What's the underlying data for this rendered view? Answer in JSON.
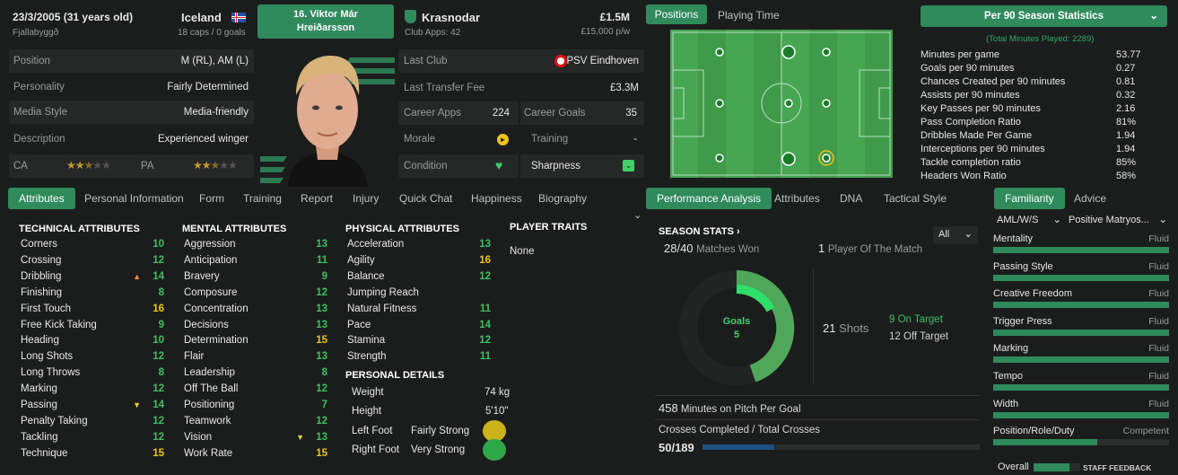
{
  "player": {
    "dob": "23/3/2005 (31 years old)",
    "birthplace": "Fjallabyggð",
    "nation": "Iceland",
    "caps": "18 caps / 0 goals",
    "name": "16. Viktor Már Hreiðarsson",
    "club": "Krasnodar",
    "club_apps": "Club Apps: 42",
    "value": "£1.5M",
    "wage": "£15,000 p/w"
  },
  "info": [
    {
      "label": "Position",
      "value": "M (RL), AM (L)"
    },
    {
      "label": "Personality",
      "value": "Fairly Determined"
    },
    {
      "label": "Media Style",
      "value": "Media-friendly"
    },
    {
      "label": "Description",
      "value": "Experienced winger"
    }
  ],
  "ratings": {
    "ca_label": "CA",
    "pa_label": "PA",
    "ca_stars": 2.5,
    "pa_stars": 2.5
  },
  "career": {
    "last_club_label": "Last Club",
    "last_club": "PSV Eindhoven",
    "fee_label": "Last Transfer Fee",
    "fee": "£3.3M",
    "apps_label": "Career Apps",
    "apps": "224",
    "goals_label": "Career Goals",
    "goals": "35",
    "morale_label": "Morale",
    "training_label": "Training",
    "training": "-",
    "condition_label": "Condition",
    "sharpness_label": "Sharpness"
  },
  "tabs_left": [
    "Attributes",
    "Personal Information",
    "Form",
    "Training",
    "Report",
    "Injury",
    "Quick Chat",
    "Happiness",
    "Biography"
  ],
  "tabs_pitch": [
    "Positions",
    "Playing Time"
  ],
  "tabs_perf": [
    "Performance Analysis",
    "Attributes",
    "DNA",
    "Tactical Style"
  ],
  "tabs_fam": [
    "Familiarity",
    "Advice"
  ],
  "technical": {
    "title": "TECHNICAL ATTRIBUTES",
    "items": [
      {
        "n": "Corners",
        "v": "10"
      },
      {
        "n": "Crossing",
        "v": "12"
      },
      {
        "n": "Dribbling",
        "v": "14"
      },
      {
        "n": "Finishing",
        "v": "8"
      },
      {
        "n": "First Touch",
        "v": "16"
      },
      {
        "n": "Free Kick Taking",
        "v": "9"
      },
      {
        "n": "Heading",
        "v": "10"
      },
      {
        "n": "Long Shots",
        "v": "12"
      },
      {
        "n": "Long Throws",
        "v": "8"
      },
      {
        "n": "Marking",
        "v": "12"
      },
      {
        "n": "Passing",
        "v": "14"
      },
      {
        "n": "Penalty Taking",
        "v": "12"
      },
      {
        "n": "Tackling",
        "v": "12"
      },
      {
        "n": "Technique",
        "v": "15"
      }
    ]
  },
  "mental": {
    "title": "MENTAL ATTRIBUTES",
    "items": [
      {
        "n": "Aggression",
        "v": "13"
      },
      {
        "n": "Anticipation",
        "v": "11"
      },
      {
        "n": "Bravery",
        "v": "9"
      },
      {
        "n": "Composure",
        "v": "12"
      },
      {
        "n": "Concentration",
        "v": "13"
      },
      {
        "n": "Decisions",
        "v": "13"
      },
      {
        "n": "Determination",
        "v": "15"
      },
      {
        "n": "Flair",
        "v": "13"
      },
      {
        "n": "Leadership",
        "v": "8"
      },
      {
        "n": "Off The Ball",
        "v": "12"
      },
      {
        "n": "Positioning",
        "v": "7"
      },
      {
        "n": "Teamwork",
        "v": "12"
      },
      {
        "n": "Vision",
        "v": "13"
      },
      {
        "n": "Work Rate",
        "v": "15"
      }
    ]
  },
  "physical": {
    "title": "PHYSICAL ATTRIBUTES",
    "items": [
      {
        "n": "Acceleration",
        "v": "13"
      },
      {
        "n": "Agility",
        "v": "16"
      },
      {
        "n": "Balance",
        "v": "12"
      },
      {
        "n": "Jumping Reach",
        "v": ""
      },
      {
        "n": "Natural Fitness",
        "v": "11"
      },
      {
        "n": "Pace",
        "v": "14"
      },
      {
        "n": "Stamina",
        "v": "12"
      },
      {
        "n": "Strength",
        "v": "11"
      }
    ]
  },
  "traits": {
    "title": "PLAYER TRAITS",
    "value": "None"
  },
  "personal": {
    "title": "PERSONAL DETAILS",
    "weight_label": "Weight",
    "weight": "74 kg",
    "height_label": "Height",
    "height": "5'10\"",
    "left_label": "Left Foot",
    "left": "Fairly Strong",
    "right_label": "Right Foot",
    "right": "Very Strong"
  },
  "per90": {
    "selector": "Per 90 Season Statistics",
    "total": "(Total Minutes Played: 2289)",
    "items": [
      {
        "n": "Minutes per game",
        "v": "53.77"
      },
      {
        "n": "Goals per 90 minutes",
        "v": "0.27"
      },
      {
        "n": "Chances Created per 90 minutes",
        "v": "0.81"
      },
      {
        "n": "Assists per 90 minutes",
        "v": "0.32"
      },
      {
        "n": "Key Passes per 90 minutes",
        "v": "2.16"
      },
      {
        "n": "Pass Completion Ratio",
        "v": "81%"
      },
      {
        "n": "Dribbles Made Per Game",
        "v": "1.94"
      },
      {
        "n": "Interceptions per 90 minutes",
        "v": "1.94"
      },
      {
        "n": "Tackle completion ratio",
        "v": "85%"
      },
      {
        "n": "Headers Won Ratio",
        "v": "58%"
      }
    ]
  },
  "season": {
    "title": "SEASON STATS",
    "filter": "All",
    "matches_won": "28/40",
    "matches_won_label": "Matches Won",
    "potm": "1",
    "potm_label": "Player Of The Match",
    "goals_label": "Goals",
    "goals": "5",
    "shots": "21",
    "shots_label": "Shots",
    "on_target": "9",
    "on_target_label": "On Target",
    "off_target": "12",
    "off_target_label": "Off Target",
    "mins_per_goal": "458",
    "mins_per_goal_label": "Minutes on Pitch Per Goal",
    "crosses_label": "Crosses Completed / Total Crosses",
    "crosses": "50/189",
    "crosses_fraction": 0.26
  },
  "familiarity": {
    "role": "AML/W/S",
    "duty": "Positive Matryos...",
    "items": [
      {
        "n": "Mentality",
        "v": "Fluid",
        "level": 1.0
      },
      {
        "n": "Passing Style",
        "v": "Fluid",
        "level": 1.0
      },
      {
        "n": "Creative Freedom",
        "v": "Fluid",
        "level": 1.0
      },
      {
        "n": "Trigger Press",
        "v": "Fluid",
        "level": 1.0
      },
      {
        "n": "Marking",
        "v": "Fluid",
        "level": 1.0
      },
      {
        "n": "Tempo",
        "v": "Fluid",
        "level": 1.0
      },
      {
        "n": "Width",
        "v": "Fluid",
        "level": 1.0
      },
      {
        "n": "Position/Role/Duty",
        "v": "Competent",
        "level": 0.59
      }
    ],
    "overall_label": "Overall",
    "staff_label": "STAFF FEEDBACK"
  },
  "colors": {
    "accent": "#2f8a5c",
    "good": "#3fbf5f",
    "high": "#f0c419",
    "pitch": "#3f9a4a"
  }
}
